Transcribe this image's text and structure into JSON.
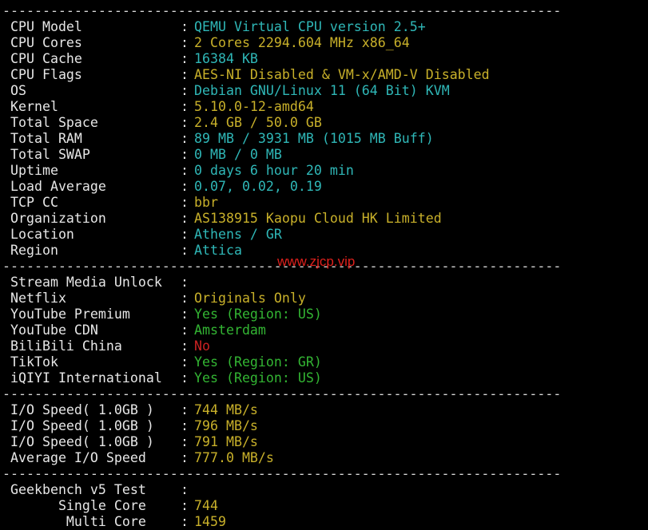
{
  "separator": "----------------------------------------------------------------------",
  "system": [
    {
      "label": "CPU Model",
      "value": "QEMU Virtual CPU version 2.5+",
      "color": "cyan"
    },
    {
      "label": "CPU Cores",
      "value": "2 Cores 2294.604 MHz x86_64",
      "color": "yellow"
    },
    {
      "label": "CPU Cache",
      "value": "16384 KB",
      "color": "cyan"
    },
    {
      "label": "CPU Flags",
      "value": "AES-NI Disabled & VM-x/AMD-V Disabled",
      "color": "yellow"
    },
    {
      "label": "OS",
      "value": "Debian GNU/Linux 11 (64 Bit) KVM",
      "color": "cyan"
    },
    {
      "label": "Kernel",
      "value": "5.10.0-12-amd64",
      "color": "yellow"
    },
    {
      "label": "Total Space",
      "value": "2.4 GB / 50.0 GB",
      "color": "yellow"
    },
    {
      "label": "Total RAM",
      "value": "89 MB / 3931 MB (1015 MB Buff)",
      "color": "cyan"
    },
    {
      "label": "Total SWAP",
      "value": "0 MB / 0 MB",
      "color": "cyan"
    },
    {
      "label": "Uptime",
      "value": "0 days 6 hour 20 min",
      "color": "cyan"
    },
    {
      "label": "Load Average",
      "value": "0.07, 0.02, 0.19",
      "color": "cyan"
    },
    {
      "label": "TCP CC",
      "value": "bbr",
      "color": "yellow"
    },
    {
      "label": "Organization",
      "value": "AS138915 Kaopu Cloud HK Limited",
      "color": "yellow"
    },
    {
      "label": "Location",
      "value": "Athens / GR",
      "color": "cyan"
    },
    {
      "label": "Region",
      "value": "Attica",
      "color": "cyan"
    }
  ],
  "watermark": "www.zjcp.vip",
  "stream": [
    {
      "label": "Stream Media Unlock",
      "value": "",
      "color": "default"
    },
    {
      "label": "Netflix",
      "value": "Originals Only",
      "color": "yellow"
    },
    {
      "label": "YouTube Premium",
      "value": "Yes (Region: US)",
      "color": "green"
    },
    {
      "label": "YouTube CDN",
      "value": "Amsterdam",
      "color": "green"
    },
    {
      "label": "BiliBili China",
      "value": "No",
      "color": "red"
    },
    {
      "label": "TikTok",
      "value": "Yes (Region: GR)",
      "color": "green"
    },
    {
      "label": "iQIYI International",
      "value": "Yes (Region: US)",
      "color": "green"
    }
  ],
  "io": [
    {
      "label": "I/O Speed( 1.0GB )",
      "value": "744 MB/s",
      "color": "yellow"
    },
    {
      "label": "I/O Speed( 1.0GB )",
      "value": "796 MB/s",
      "color": "yellow"
    },
    {
      "label": "I/O Speed( 1.0GB )",
      "value": "791 MB/s",
      "color": "yellow"
    },
    {
      "label": "Average I/O Speed",
      "value": "777.0 MB/s",
      "color": "yellow"
    }
  ],
  "geekbench": [
    {
      "label": "Geekbench v5 Test",
      "value": "",
      "color": "default"
    },
    {
      "label": "      Single Core",
      "value": "744",
      "color": "yellow"
    },
    {
      "label": "       Multi Core",
      "value": "1459",
      "color": "yellow"
    }
  ],
  "colors": {
    "background": "#000000",
    "default": "#e6e6e6",
    "cyan": "#2fb7b7",
    "yellow": "#c8b02a",
    "green": "#33b533",
    "red": "#cc2222",
    "watermark": "#e0201c"
  }
}
